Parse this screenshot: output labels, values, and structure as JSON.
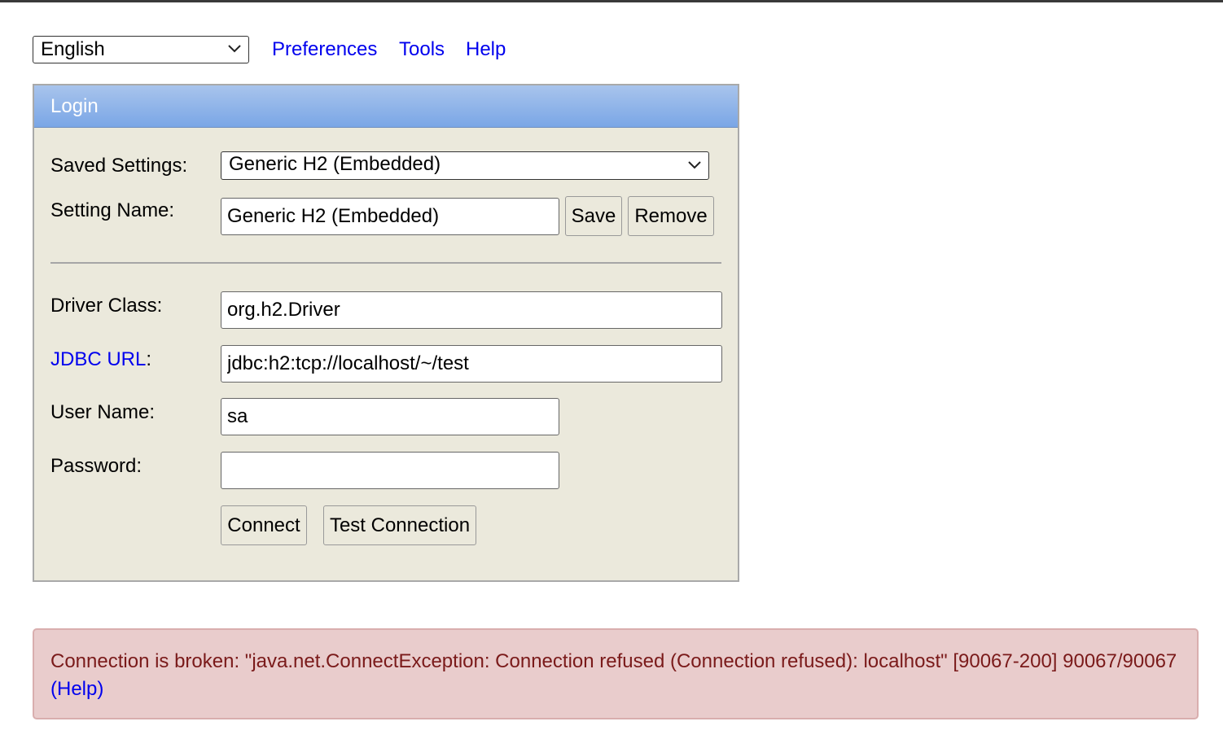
{
  "top_bar": {
    "language": "English",
    "links": [
      "Preferences",
      "Tools",
      "Help"
    ]
  },
  "login": {
    "title": "Login",
    "saved_settings_label": "Saved Settings:",
    "saved_settings_value": "Generic H2 (Embedded)",
    "setting_name_label": "Setting Name:",
    "setting_name_value": "Generic H2 (Embedded)",
    "save_label": "Save",
    "remove_label": "Remove",
    "driver_class_label": "Driver Class:",
    "driver_class_value": "org.h2.Driver",
    "jdbc_url_link": "JDBC URL",
    "jdbc_url_colon": ":",
    "jdbc_url_value": "jdbc:h2:tcp://localhost/~/test",
    "user_name_label": "User Name:",
    "user_name_value": "sa",
    "password_label": "Password:",
    "password_value": "",
    "connect_label": "Connect",
    "test_connection_label": "Test Connection"
  },
  "error": {
    "message": "Connection is broken: \"java.net.ConnectException: Connection refused (Connection refused): localhost\" [90067-200] 90067/90067",
    "help_link": "(Help)"
  },
  "colors": {
    "link": "#0000ee",
    "header_gradient_top": "#a8c4ec",
    "header_gradient_bottom": "#7aa6e6",
    "panel_bg": "#ebe9dc",
    "error_bg": "#e9cccc",
    "error_text": "#7a1a1a"
  },
  "icons": {
    "select_arrow": "chevron-down-icon"
  }
}
